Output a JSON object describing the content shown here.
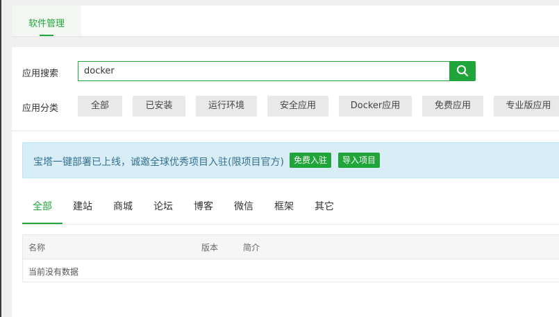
{
  "top_tab": {
    "label": "软件管理"
  },
  "search": {
    "label": "应用搜索",
    "value": "docker",
    "icon": "search-icon"
  },
  "category": {
    "label": "应用分类",
    "items": [
      "全部",
      "已安装",
      "运行环境",
      "安全应用",
      "Docker应用",
      "免费应用",
      "专业版应用"
    ]
  },
  "notice": {
    "text": "宝塔一键部署已上线，诚邀全球优秀项目入驻(限项目官方)",
    "btn_free": "免费入驻",
    "btn_import": "导入项目"
  },
  "tabs": {
    "items": [
      "全部",
      "建站",
      "商城",
      "论坛",
      "博客",
      "微信",
      "框架",
      "其它"
    ],
    "active": "全部"
  },
  "table": {
    "headers": [
      "名称",
      "版本",
      "简介"
    ],
    "empty_text": "当前没有数据"
  },
  "colors": {
    "accent": "#20a53a",
    "notice_bg": "#d9edf7",
    "notice_text": "#31708f"
  }
}
